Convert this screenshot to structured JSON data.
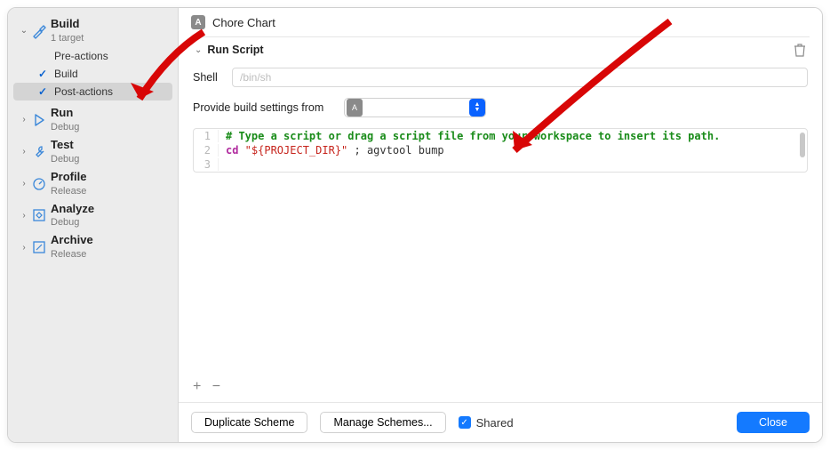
{
  "scheme_name": "Chore Chart",
  "sidebar": {
    "build": {
      "title": "Build",
      "subtitle": "1 target"
    },
    "build_children": {
      "pre": "Pre-actions",
      "build": "Build",
      "post": "Post-actions"
    },
    "run": {
      "title": "Run",
      "subtitle": "Debug"
    },
    "test": {
      "title": "Test",
      "subtitle": "Debug"
    },
    "profile": {
      "title": "Profile",
      "subtitle": "Release"
    },
    "analyze": {
      "title": "Analyze",
      "subtitle": "Debug"
    },
    "archive": {
      "title": "Archive",
      "subtitle": "Release"
    }
  },
  "panel": {
    "section_title": "Run Script",
    "shell_label": "Shell",
    "shell_placeholder": "/bin/sh",
    "settings_label": "Provide build settings from",
    "code": {
      "line1": "# Type a script or drag a script file from your workspace to insert its path.",
      "line2_cmd": "cd",
      "line2_arg": " \"${PROJECT_DIR}\"",
      "line2_rest": " ; agvtool bump"
    }
  },
  "footer": {
    "duplicate": "Duplicate Scheme",
    "manage": "Manage Schemes...",
    "shared": "Shared",
    "close": "Close"
  }
}
